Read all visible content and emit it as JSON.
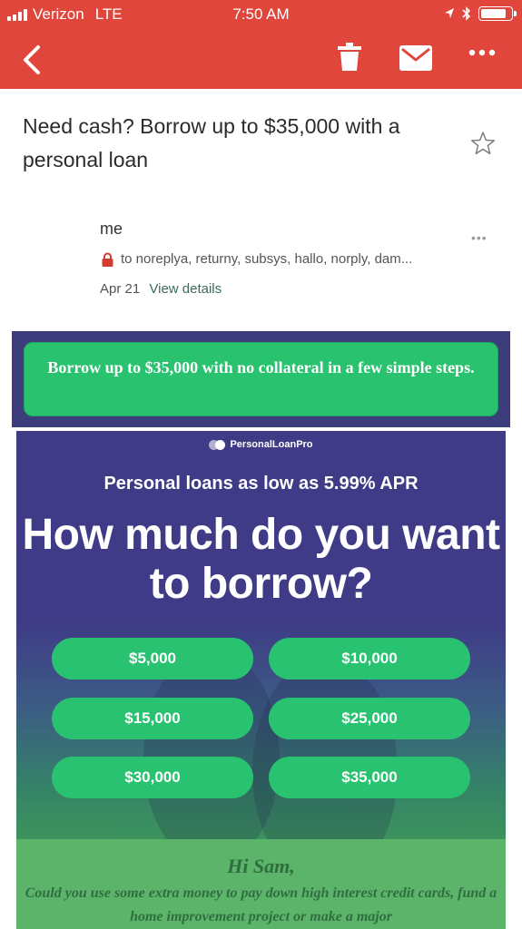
{
  "status_bar": {
    "carrier": "Verizon",
    "network": "LTE",
    "time": "7:50 AM"
  },
  "toolbar": {
    "icons": [
      "back-arrow",
      "trash",
      "mail",
      "more-dots"
    ],
    "color": "#e0463b"
  },
  "email": {
    "subject": "Need cash? Borrow up to $35,000 with a personal loan",
    "sender": "me",
    "recipients": "to noreplya, returny, subsys, hallo, norply, dam...",
    "date": "Apr 21",
    "view_details": "View details",
    "more": "•••"
  },
  "body": {
    "cta_button": "Borrow up to $35,000 with no collateral in a few simple steps.",
    "brand": "PersonalLoanPro",
    "subheadline": "Personal loans as low as 5.99% APR",
    "headline": "How much do you want to borrow?",
    "amounts": [
      "$5,000",
      "$10,000",
      "$15,000",
      "$25,000",
      "$30,000",
      "$35,000"
    ],
    "greeting": "Hi Sam,",
    "paragraph": "Could you use some extra money to pay down high interest credit cards, fund a home improvement project or make a major",
    "accent": "#29c36f"
  }
}
